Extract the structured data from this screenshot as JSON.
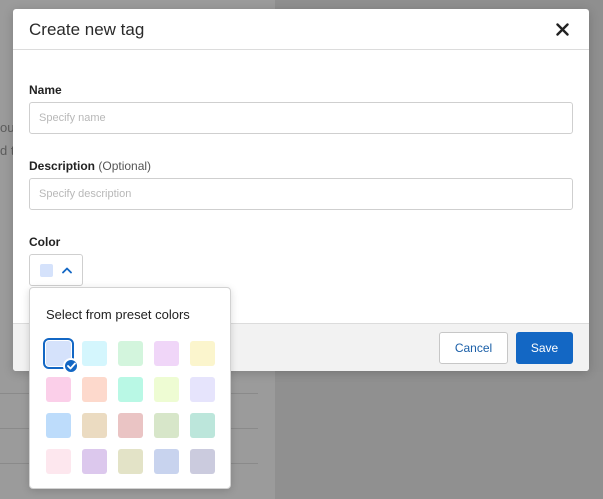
{
  "background": {
    "fragment_1": "oun",
    "fragment_2": "d t"
  },
  "dialog": {
    "title": "Create new tag",
    "close_icon": "close-icon",
    "name": {
      "label": "Name",
      "placeholder": "Specify name",
      "value": ""
    },
    "description": {
      "label": "Description",
      "optional": "(Optional)",
      "placeholder": "Specify description",
      "value": ""
    },
    "color": {
      "label": "Color",
      "selected_color": "#d5e2fb",
      "toggle_icon": "chevron-up-icon"
    },
    "footer": {
      "cancel_label": "Cancel",
      "save_label": "Save"
    }
  },
  "color_picker": {
    "title": "Select from preset colors",
    "selected_index": 0,
    "presets": [
      "#d5e2fb",
      "#d4f6fd",
      "#d3f5dd",
      "#f0d6f8",
      "#fbf5cd",
      "#fbcfe9",
      "#fdd9cc",
      "#b9f8e5",
      "#eefcd3",
      "#e6e4fc",
      "#bddcfb",
      "#ebdbc1",
      "#eac4c4",
      "#d7e6c9",
      "#bce6db",
      "#fde7ee",
      "#dcc8ed",
      "#e3e3c7",
      "#c8d3ee",
      "#cbcbde"
    ]
  },
  "theme": {
    "accent": "#1367c4",
    "check_icon": "check-icon"
  }
}
